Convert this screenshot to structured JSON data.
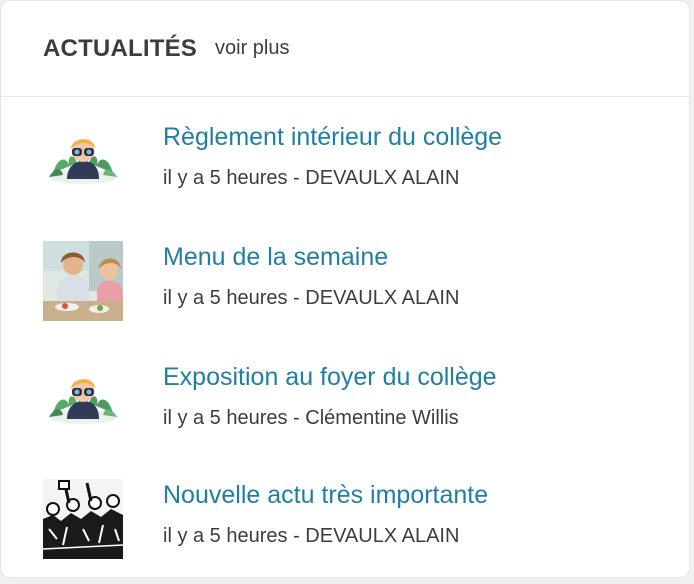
{
  "widget": {
    "title": "ACTUALITÉS",
    "see_more_label": "voir plus"
  },
  "news": [
    {
      "title": "Règlement intérieur du collège",
      "meta": "il y a 5 heures - DEVAULX ALAIN",
      "thumbnail": "illustration-binoculars-icon"
    },
    {
      "title": "Menu de la semaine",
      "meta": "il y a 5 heures - DEVAULX ALAIN",
      "thumbnail": "photo-children-eating"
    },
    {
      "title": "Exposition au foyer du collège",
      "meta": "il y a 5 heures - Clémentine Willis",
      "thumbnail": "illustration-binoculars-icon"
    },
    {
      "title": "Nouvelle actu très importante",
      "meta": "il y a 5 heures - DEVAULX ALAIN",
      "thumbnail": "sketch-crowd-protest"
    }
  ],
  "colors": {
    "title_link": "#1f7fa3",
    "text": "#3a3d42",
    "border": "#e3e5e8"
  }
}
